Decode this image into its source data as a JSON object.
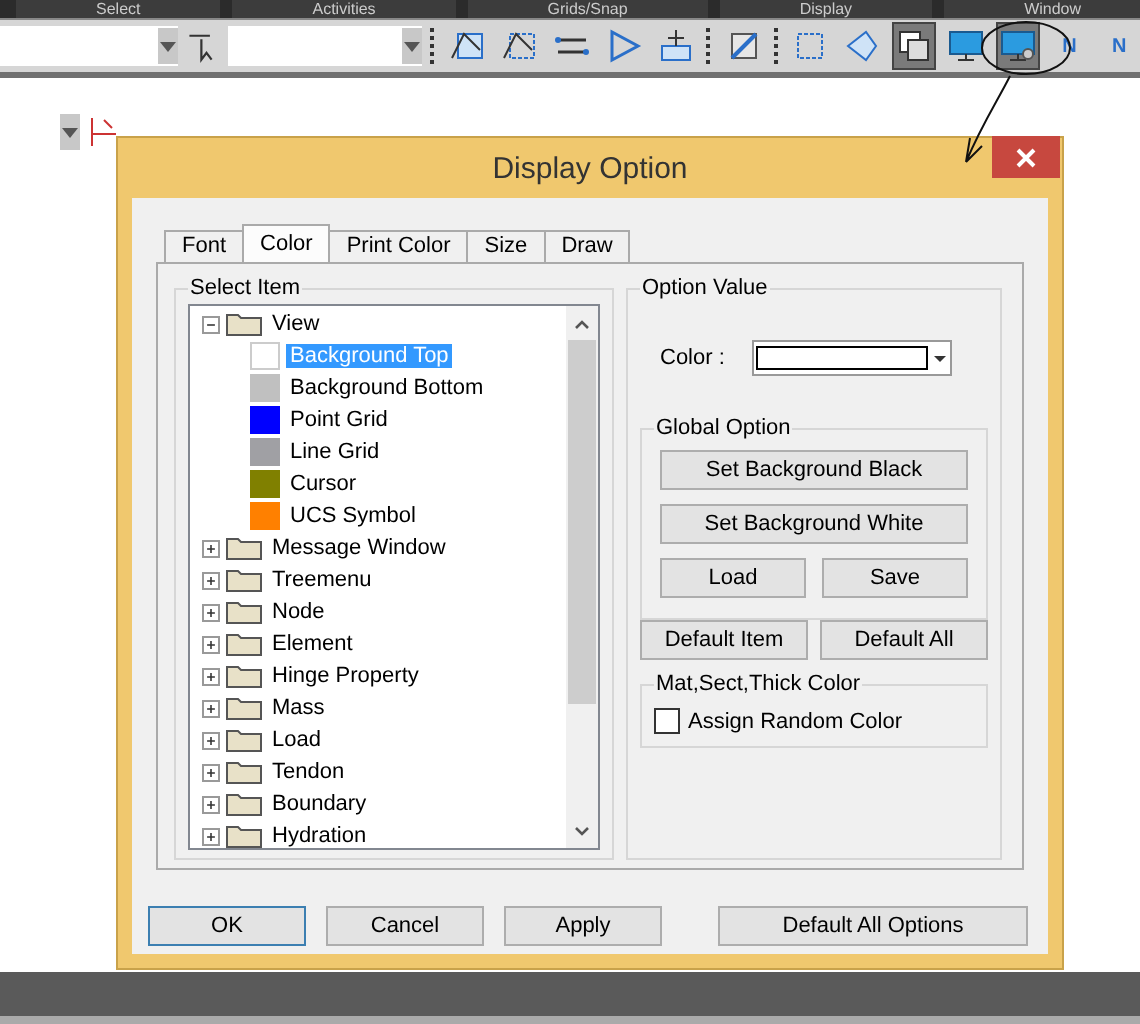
{
  "menu_tabs": [
    "Select",
    "Activities",
    "Grids/Snap",
    "Display",
    "Window"
  ],
  "toolbar": {
    "buttons": [
      {
        "selected": false
      },
      {
        "selected": false
      },
      {
        "selected": false
      },
      {
        "selected": false
      },
      {
        "selected": false
      },
      {
        "selected": false
      },
      {
        "selected": false
      },
      {
        "selected": false
      },
      {
        "selected": true
      },
      {
        "selected": false
      },
      {
        "selected": true
      },
      {
        "selected": false,
        "label": "N"
      },
      {
        "selected": false,
        "label": "N"
      }
    ]
  },
  "dialog": {
    "title": "Display Option",
    "tabs": [
      {
        "label": "Font",
        "selected": false
      },
      {
        "label": "Color",
        "selected": true
      },
      {
        "label": "Print Color",
        "selected": false
      },
      {
        "label": "Size",
        "selected": false
      },
      {
        "label": "Draw",
        "selected": false
      }
    ],
    "select_item": {
      "title": "Select Item",
      "tree": [
        {
          "label": "View",
          "expanded": true,
          "selected": false,
          "children": [
            {
              "label": "Background Top",
              "color": "#ffffff",
              "selected": true
            },
            {
              "label": "Background Bottom",
              "color": "#c0c0c0",
              "selected": false
            },
            {
              "label": "Point Grid",
              "color": "#0000ff",
              "selected": false
            },
            {
              "label": "Line Grid",
              "color": "#a0a0a4",
              "selected": false
            },
            {
              "label": "Cursor",
              "color": "#808000",
              "selected": false
            },
            {
              "label": "UCS Symbol",
              "color": "#ff8000",
              "selected": false
            }
          ]
        },
        {
          "label": "Message Window",
          "expanded": false,
          "selected": false
        },
        {
          "label": "Treemenu",
          "expanded": false,
          "selected": false
        },
        {
          "label": "Node",
          "expanded": false,
          "selected": false
        },
        {
          "label": "Element",
          "expanded": false,
          "selected": false
        },
        {
          "label": "Hinge Property",
          "expanded": false,
          "selected": false
        },
        {
          "label": "Mass",
          "expanded": false,
          "selected": false
        },
        {
          "label": "Load",
          "expanded": false,
          "selected": false
        },
        {
          "label": "Tendon",
          "expanded": false,
          "selected": false
        },
        {
          "label": "Boundary",
          "expanded": false,
          "selected": false
        },
        {
          "label": "Hydration",
          "expanded": false,
          "selected": false
        }
      ]
    },
    "option_value": {
      "title": "Option Value",
      "color_label": "Color :",
      "color": "#ffffff",
      "global_option": {
        "title": "Global Option",
        "buttons": [
          "Set Background Black",
          "Set Background White"
        ],
        "load": "Load",
        "save": "Save"
      },
      "default_item": "Default Item",
      "default_all": "Default All",
      "mat_group": {
        "title": "Mat,Sect,Thick Color",
        "checkbox": {
          "label": "Assign Random Color",
          "checked": false
        }
      }
    },
    "buttons": [
      {
        "label": "OK",
        "default": true
      },
      {
        "label": "Cancel",
        "default": false
      },
      {
        "label": "Apply",
        "default": false
      },
      {
        "label": "Default All Options",
        "default": false
      }
    ]
  }
}
